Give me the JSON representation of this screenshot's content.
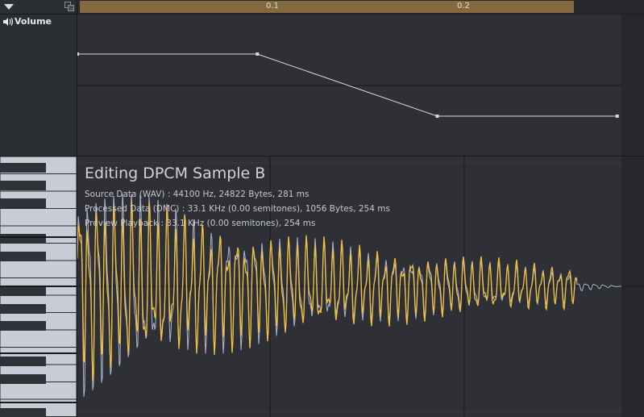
{
  "ruler": {
    "ticks": [
      "0.1",
      "0.2"
    ]
  },
  "envelope": {
    "label": "Volume",
    "points": [
      {
        "t": 0.0,
        "v": 0.72
      },
      {
        "t": 0.1,
        "v": 0.72
      },
      {
        "t": 0.2,
        "v": 0.28
      },
      {
        "t": 0.3,
        "v": 0.28
      }
    ]
  },
  "sample": {
    "title": "Editing DPCM Sample B",
    "source": "Source Data (WAV) : 44100 Hz, 24822 Bytes, 281 ms",
    "processed": "Processed Data (DMC) : 33.1 KHz (0.00 semitones), 1056 Bytes, 254 ms",
    "preview": "Preview Playback : 33.1 KHz (0.00 semitones), 254 ms"
  },
  "colors": {
    "source_wave": "#aeb8d0",
    "processed_wave": "#f0c040",
    "ruler_bar": "#826a3e",
    "envelope_line": "#d8dade"
  },
  "icons": {
    "collapse": "triangle-down-icon",
    "expand": "expand-icon",
    "volume": "speaker-icon"
  }
}
